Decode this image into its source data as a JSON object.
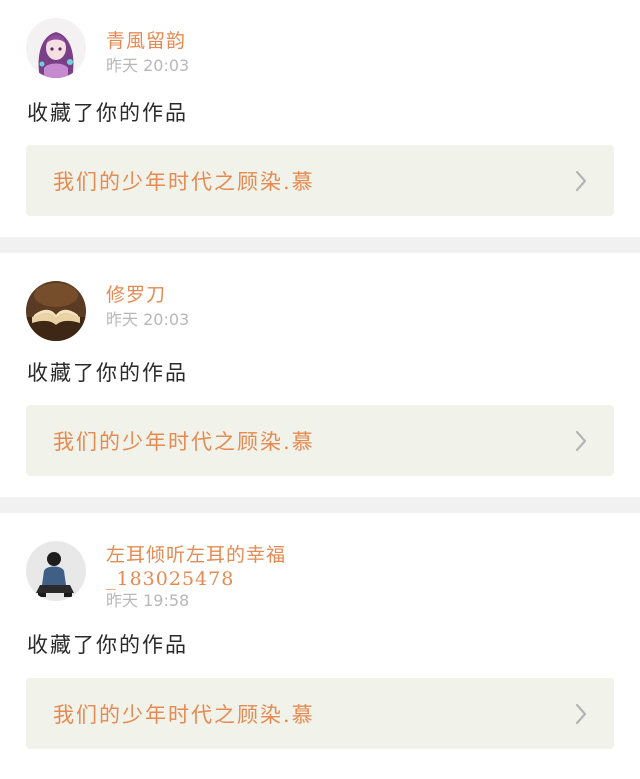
{
  "items": [
    {
      "username": "青風留韵",
      "time": "昨天 20:03",
      "action": "收藏了你的作品",
      "work_title": "我们的少年时代之顾染.慕",
      "avatar_icon": "anime-girl-avatar-icon"
    },
    {
      "username": "修罗刀",
      "time": "昨天 20:03",
      "action": "收藏了你的作品",
      "work_title": "我们的少年时代之顾染.慕",
      "avatar_icon": "open-book-avatar-icon"
    },
    {
      "username": "左耳倾听左耳的幸福",
      "username_suffix": "_183025478",
      "time": "昨天 19:58",
      "action": "收藏了你的作品",
      "work_title": "我们的少年时代之顾染.慕",
      "avatar_icon": "person-sitting-avatar-icon"
    }
  ],
  "colors": {
    "accent": "#e58a52",
    "card_bg": "#f1f3ea",
    "separator": "#f1f1f1",
    "muted": "#b8b8b8",
    "text": "#2a2a2a"
  }
}
